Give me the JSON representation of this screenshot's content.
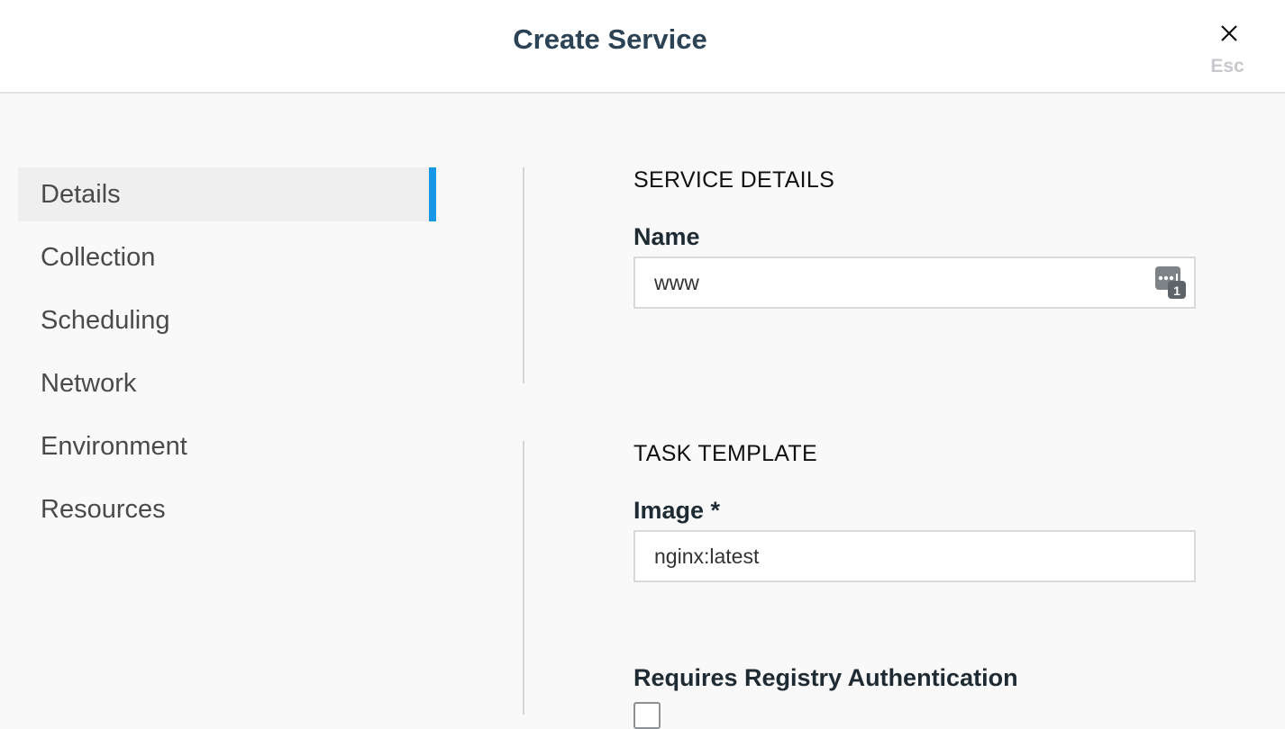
{
  "header": {
    "title": "Create Service",
    "close_label": "Esc"
  },
  "sidebar": {
    "items": [
      {
        "label": "Details",
        "active": true
      },
      {
        "label": "Collection",
        "active": false
      },
      {
        "label": "Scheduling",
        "active": false
      },
      {
        "label": "Network",
        "active": false
      },
      {
        "label": "Environment",
        "active": false
      },
      {
        "label": "Resources",
        "active": false
      }
    ]
  },
  "service_details": {
    "section_title": "SERVICE DETAILS",
    "name_label": "Name",
    "name_value": "www",
    "name_field_icon": "keychain-password-icon"
  },
  "task_template": {
    "section_title": "TASK TEMPLATE",
    "image_label": "Image *",
    "image_value": "nginx:latest",
    "registry_auth_label": "Requires Registry Authentication",
    "registry_auth_checked": false
  },
  "colors": {
    "accent": "#1797e6",
    "title": "#2c4255"
  }
}
